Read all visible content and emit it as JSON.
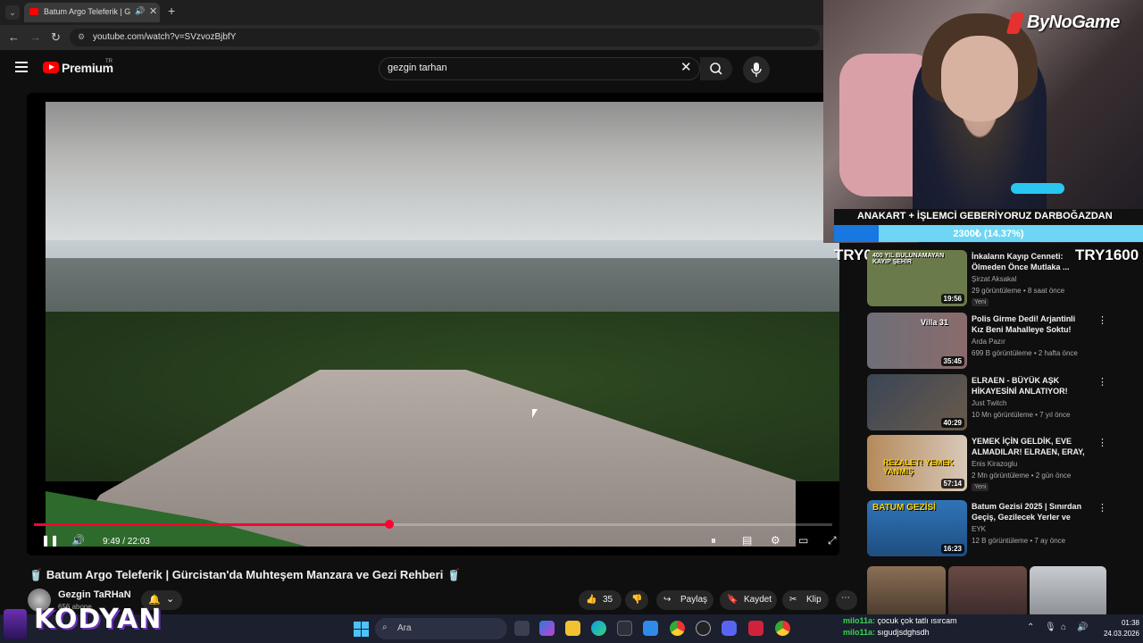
{
  "browser": {
    "tab_title": "Batum Argo Teleferik | G",
    "url": "youtube.com/watch?v=SVzvozBjbfY"
  },
  "youtube": {
    "brand": "Premium",
    "country": "TR",
    "search_value": "gezgin tarhan"
  },
  "player": {
    "time_display": "9:49 / 22:03",
    "progress_fraction": 0.445
  },
  "video": {
    "title_prefix": "🥤",
    "title": "Batum Argo Teleferik | Gürcistan'da Muhteşem Manzara ve Gezi Rehberi",
    "title_suffix": "🥤",
    "channel": "Gezgin TaRHaN",
    "subscribers": "656 abone",
    "likes": "35",
    "share_label": "Paylaş",
    "save_label": "Kaydet",
    "clip_label": "Klip"
  },
  "stream_overlay": {
    "brand": "ByNoGame",
    "banner": "ANAKART + İŞLEMCİ GEBERİYORUZ DARBOĞAZDAN",
    "goal_text": "2300₺ (14.37%)",
    "goal_fraction": 0.1437,
    "try_left": "TRY0",
    "try_right": "TRY1600",
    "streamer_name": "KODYAN"
  },
  "recommendations": [
    {
      "title": "İnkaların Kayıp Cenneti: Ölmeden Önce Mutlaka ...",
      "channel": "Şirzat Aksakal",
      "meta": "29 görüntüleme • 8 saat önce",
      "duration": "19:56",
      "badge": "Yeni",
      "thumb_label": "400 YIL BULUNAMAYAN KAYIP ŞEHİR",
      "thumb_color": "#6b7a4a"
    },
    {
      "title": "Polis Girme Dedi! Arjantinli Kız Beni Mahalleye Soktu! Villa 31",
      "channel": "Arda Pazır",
      "meta": "699 B görüntüleme • 2 hafta önce",
      "duration": "35:45",
      "badge": "",
      "thumb_label": "Villa 31",
      "thumb_color": "#6e6f78"
    },
    {
      "title": "ELRAEN - BÜYÜK AŞK HİKAYESİNİ ANLATIYOR!",
      "channel": "Just Twitch",
      "meta": "10 Mn görüntüleme • 7 yıl önce",
      "duration": "40:29",
      "badge": "",
      "thumb_label": "",
      "thumb_color": "#3a4656"
    },
    {
      "title": "YEMEK İÇİN GELDİK, EVE ALMADILAR! ELRAEN, ERAY, ...",
      "channel": "Enis Kirazoglu",
      "meta": "2 Mn görüntüleme • 2 gün önce",
      "duration": "57:14",
      "badge": "Yeni",
      "thumb_label": "REZALET! YEMEK YANMIŞ",
      "thumb_color": "#b58a5a"
    },
    {
      "title": "Batum Gezisi 2025 | Sınırdan Geçiş, Gezilecek Yerler ve Tüm...",
      "channel": "EYK",
      "meta": "12 B görüntüleme • 7 ay önce",
      "duration": "16:23",
      "badge": "",
      "thumb_label": "BATUM GEZİSİ",
      "thumb_color": "#2f74b8"
    }
  ],
  "taskbar": {
    "search_label": "Ara",
    "time": "01:38",
    "date": "24.03.2026"
  },
  "chat": [
    {
      "user": "milo11a:",
      "message": "çocuk çok tatlı ısırcam"
    },
    {
      "user": "milo11a:",
      "message": "sıgudjsdghsdh"
    }
  ],
  "colors": {
    "accent": "#ff0033",
    "goal_bar": "#1877e0",
    "goal_bg": "#6ed6f4"
  }
}
